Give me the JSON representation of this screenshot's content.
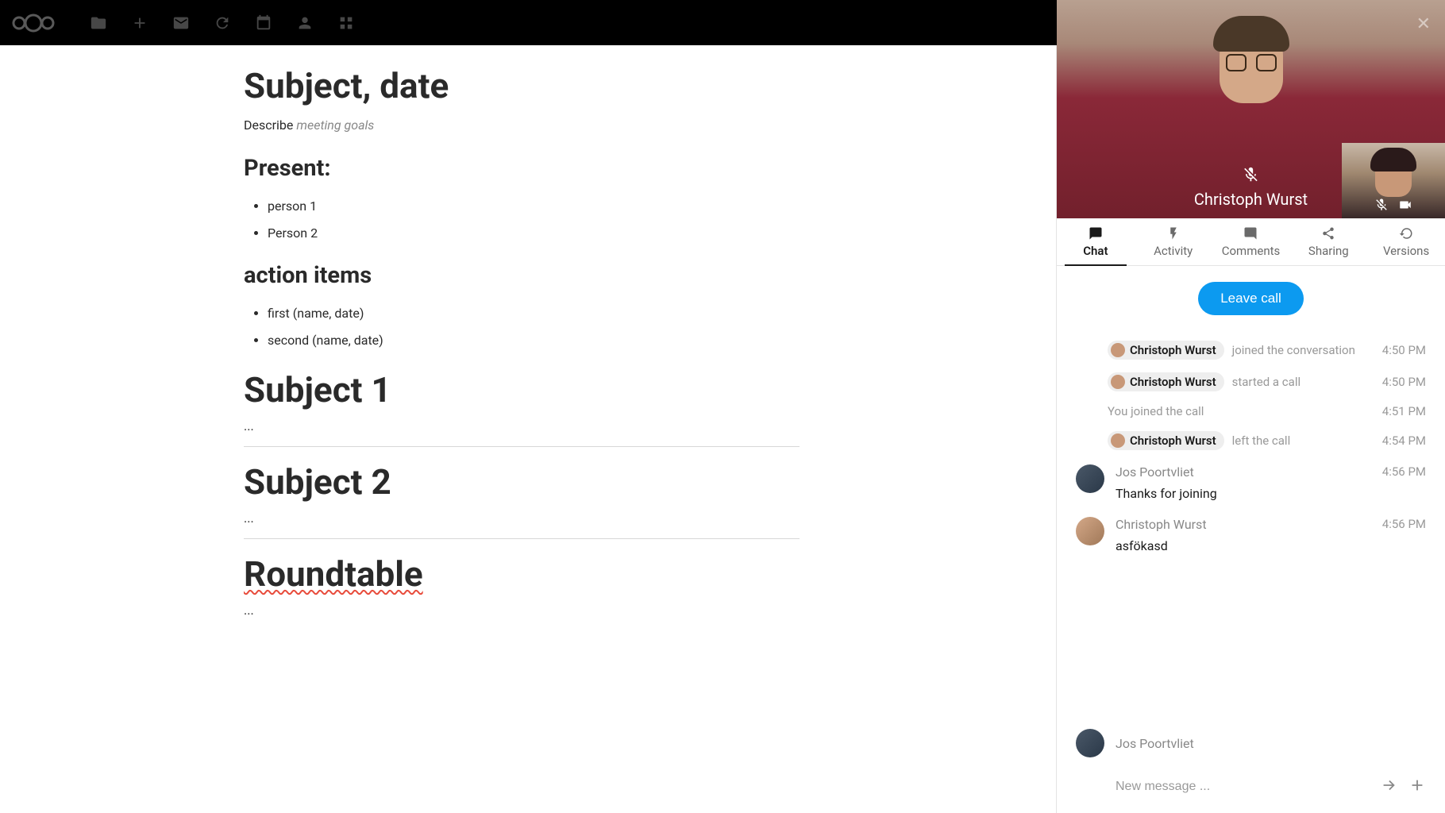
{
  "topbar": {
    "nav_icons": [
      "files-icon",
      "plus-icon",
      "mail-icon",
      "refresh-icon",
      "calendar-icon",
      "contact-icon",
      "deck-icon"
    ]
  },
  "document": {
    "title": "Subject, date",
    "describe_label": "Describe",
    "describe_placeholder": "meeting goals",
    "present_heading": "Present:",
    "present_list": [
      "person 1",
      "Person 2"
    ],
    "action_heading": "action items",
    "action_list": [
      "first (name, date)",
      "second (name, date)"
    ],
    "subject1_heading": "Subject 1",
    "subject1_body": "...",
    "subject2_heading": "Subject 2",
    "subject2_body": "...",
    "roundtable_heading": "Roundtable",
    "roundtable_body": "..."
  },
  "video": {
    "participant_name": "Christoph Wurst"
  },
  "tabs": {
    "chat": "Chat",
    "activity": "Activity",
    "comments": "Comments",
    "sharing": "Sharing",
    "versions": "Versions"
  },
  "call": {
    "leave_label": "Leave call"
  },
  "chat": {
    "events": [
      {
        "user": "Christoph Wurst",
        "action": "joined the conversation",
        "time": "4:50 PM",
        "pill": true
      },
      {
        "user": "Christoph Wurst",
        "action": "started a call",
        "time": "4:50 PM",
        "pill": true
      },
      {
        "user": "",
        "action": "You joined the call",
        "time": "4:51 PM",
        "pill": false
      },
      {
        "user": "Christoph Wurst",
        "action": "left the call",
        "time": "4:54 PM",
        "pill": true
      }
    ],
    "messages": [
      {
        "author": "Jos Poortvliet",
        "time": "4:56 PM",
        "text": "Thanks for joining",
        "avatar": "jos"
      },
      {
        "author": "Christoph Wurst",
        "time": "4:56 PM",
        "text": "asfökasd",
        "avatar": "christoph"
      }
    ],
    "compose_author": "Jos Poortvliet",
    "compose_placeholder": "New message ..."
  }
}
